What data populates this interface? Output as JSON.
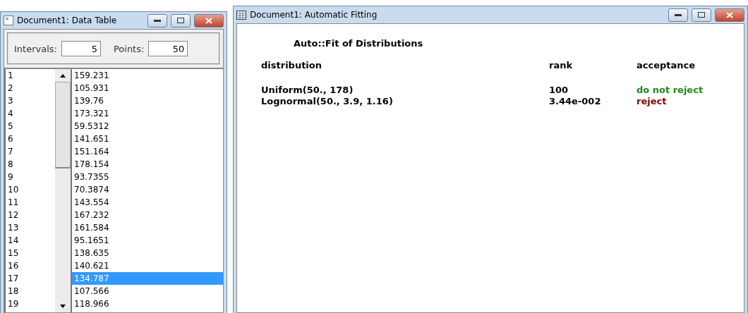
{
  "data_table": {
    "title": "Document1: Data Table",
    "intervals_label": "Intervals:",
    "intervals": "5",
    "points_label": "Points:",
    "points": "50",
    "rows": [
      {
        "index": "1",
        "value": "159.231",
        "selected": false
      },
      {
        "index": "2",
        "value": "105.931",
        "selected": false
      },
      {
        "index": "3",
        "value": "139.76",
        "selected": false
      },
      {
        "index": "4",
        "value": "173.321",
        "selected": false
      },
      {
        "index": "5",
        "value": "59.5312",
        "selected": false
      },
      {
        "index": "6",
        "value": "141.651",
        "selected": false
      },
      {
        "index": "7",
        "value": "151.164",
        "selected": false
      },
      {
        "index": "8",
        "value": "178.154",
        "selected": false
      },
      {
        "index": "9",
        "value": "93.7355",
        "selected": false
      },
      {
        "index": "10",
        "value": "70.3874",
        "selected": false
      },
      {
        "index": "11",
        "value": "143.554",
        "selected": false
      },
      {
        "index": "12",
        "value": "167.232",
        "selected": false
      },
      {
        "index": "13",
        "value": "161.584",
        "selected": false
      },
      {
        "index": "14",
        "value": "95.1651",
        "selected": false
      },
      {
        "index": "15",
        "value": "138.635",
        "selected": false
      },
      {
        "index": "16",
        "value": "140.621",
        "selected": false
      },
      {
        "index": "17",
        "value": "134.787",
        "selected": true
      },
      {
        "index": "18",
        "value": "107.566",
        "selected": false
      },
      {
        "index": "19",
        "value": "118.966",
        "selected": false
      }
    ]
  },
  "fitting": {
    "title": "Document1: Automatic Fitting",
    "heading": "Auto::Fit of Distributions",
    "columns": [
      "distribution",
      "rank",
      "acceptance"
    ],
    "results": [
      {
        "distribution": "Uniform(50., 178)",
        "rank": "100",
        "acceptance": "do not reject",
        "color": "#1a8a1a"
      },
      {
        "distribution": "Lognormal(50., 3.9, 1.16)",
        "rank": "3.44e-002",
        "acceptance": "reject",
        "color": "#800000"
      }
    ]
  }
}
